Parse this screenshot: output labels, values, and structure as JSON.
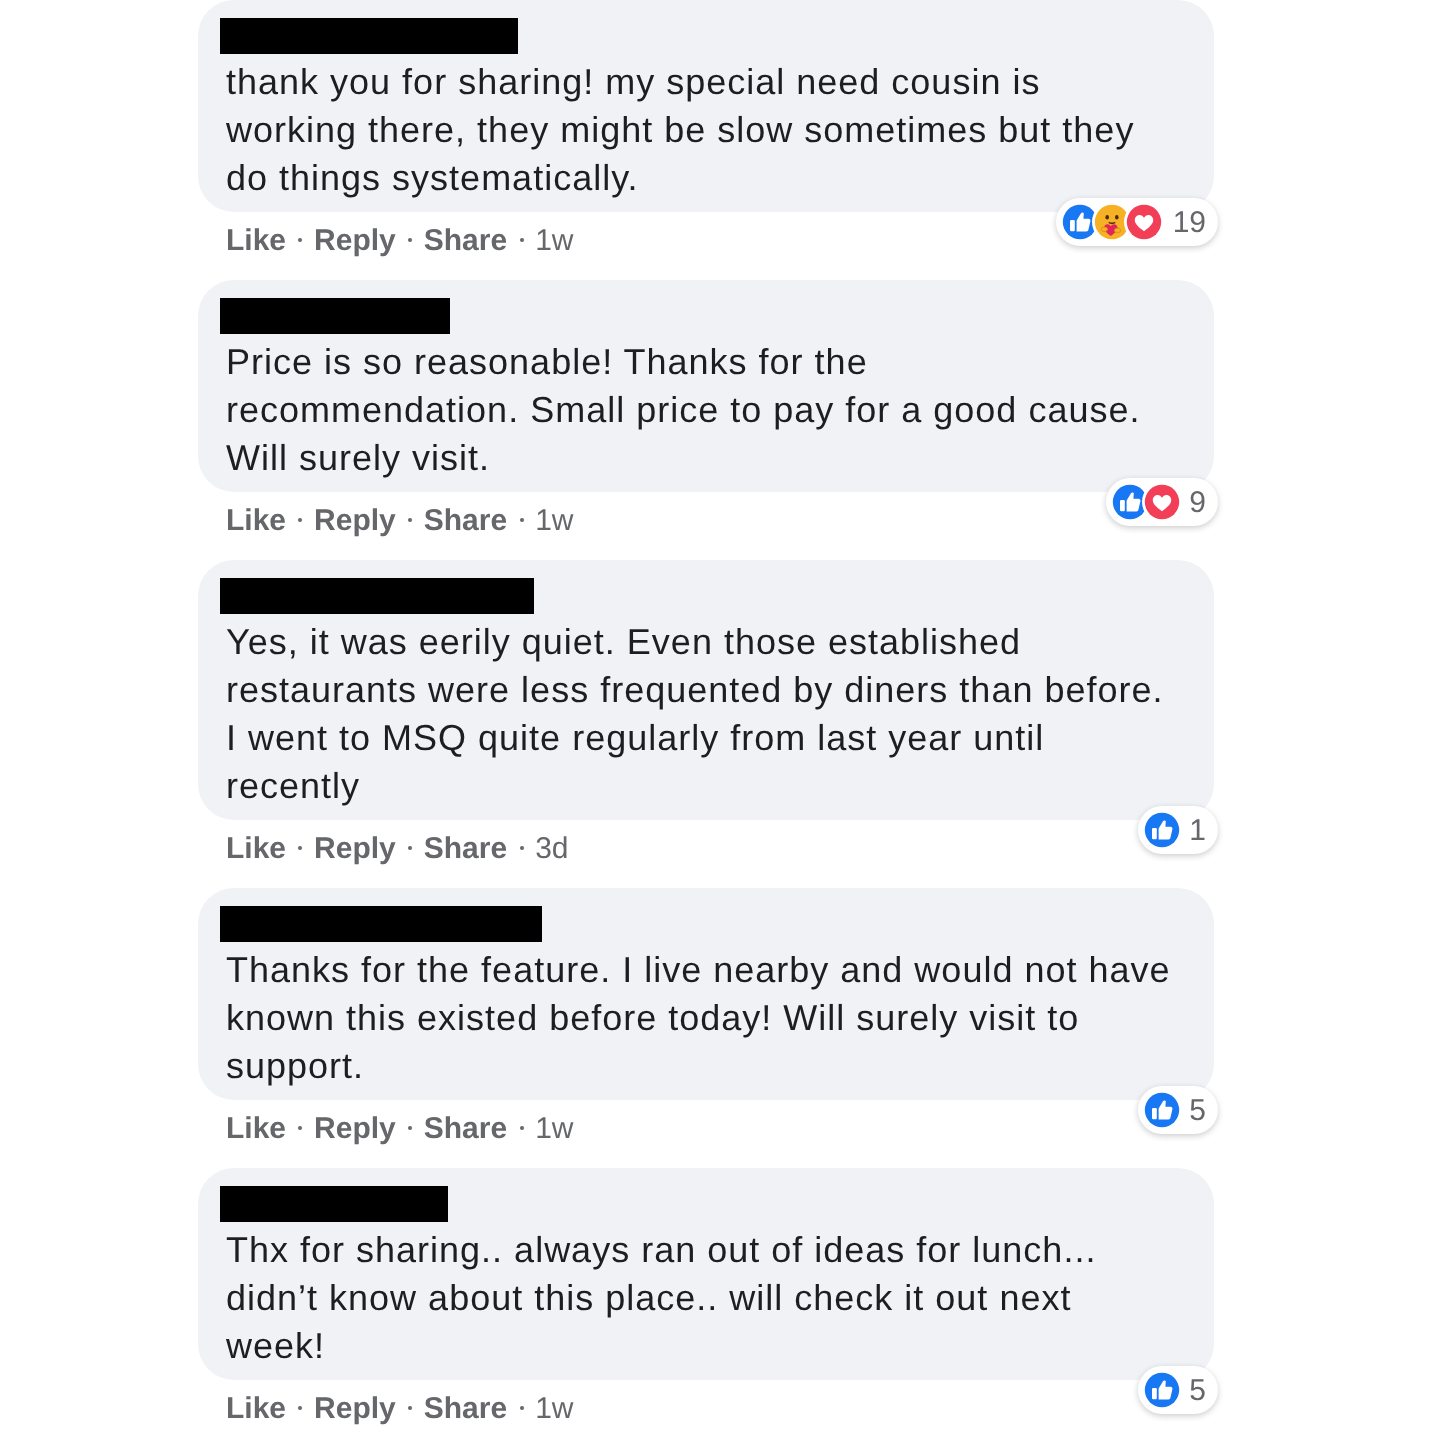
{
  "comments": [
    {
      "text_lines": [
        "thank you for sharing! my special need cousin is",
        "working there, they might be slow sometimes but they",
        "do things systematically."
      ],
      "reactions": {
        "icons": [
          {
            "kind": "like"
          },
          {
            "kind": "care"
          },
          {
            "kind": "love"
          }
        ],
        "count": "19"
      },
      "actions": [
        "Like",
        "Reply",
        "Share"
      ],
      "time": "1w"
    },
    {
      "text_lines": [
        "Price is so reasonable! Thanks for the",
        "recommendation. Small price to pay for a good cause.",
        "Will surely visit."
      ],
      "reactions": {
        "icons": [
          {
            "kind": "like"
          },
          {
            "kind": "love"
          }
        ],
        "count": "9"
      },
      "actions": [
        "Like",
        "Reply",
        "Share"
      ],
      "time": "1w"
    },
    {
      "text_lines": [
        "Yes, it was eerily quiet. Even those established",
        "restaurants were less frequented by diners than before.",
        "I went to MSQ quite regularly from last year until",
        "recently"
      ],
      "reactions": {
        "icons": [
          {
            "kind": "like"
          }
        ],
        "count": "1"
      },
      "actions": [
        "Like",
        "Reply",
        "Share"
      ],
      "time": "3d"
    },
    {
      "text_lines": [
        "Thanks for the feature. I live nearby and would not have",
        "known this existed before today! Will surely visit to",
        "support."
      ],
      "reactions": {
        "icons": [
          {
            "kind": "like"
          }
        ],
        "count": "5"
      },
      "actions": [
        "Like",
        "Reply",
        "Share"
      ],
      "time": "1w"
    },
    {
      "text_lines": [
        "Thx for sharing.. always ran out of ideas for lunch...",
        "didn’t know about this place.. will check it out next",
        "week!"
      ],
      "reactions": {
        "icons": [
          {
            "kind": "like"
          }
        ],
        "count": "5"
      },
      "actions": [
        "Like",
        "Reply",
        "Share"
      ],
      "time": "1w"
    }
  ]
}
